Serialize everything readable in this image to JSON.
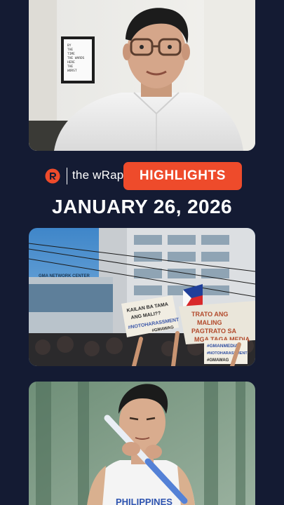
{
  "brand": {
    "logo_icon": "rappler-logo-icon",
    "name": "the wRap",
    "accent": "#ee4b2b"
  },
  "highlights_label": "HIGHLIGHTS",
  "date": "JANUARY 26, 2026",
  "stories": [
    {
      "frame_text": [
        "BY",
        "THE",
        "TIME",
        "THE WARDS",
        "HERE",
        "THE",
        "WORST"
      ]
    },
    {
      "building_sign": "GMA NETWORK CENTER",
      "sign_left": [
        "KAILAN BA TAMA",
        "ANG MALI??",
        "#NOTOHARASSMENT",
        "#GMAWAG"
      ],
      "sign_right": [
        "TRATO ANG",
        "MALING",
        "PAGTRATO SA",
        "MGA TAGA MEDIA"
      ],
      "sign_bottom": [
        "#GMANMEDIA",
        "#NOTOHARASSMENT",
        "#GMAWAG"
      ]
    },
    {
      "jersey_text": "PHILIPPINES"
    }
  ],
  "colors": {
    "background": "#141b33",
    "highlight_button": "#ee4b2b"
  }
}
